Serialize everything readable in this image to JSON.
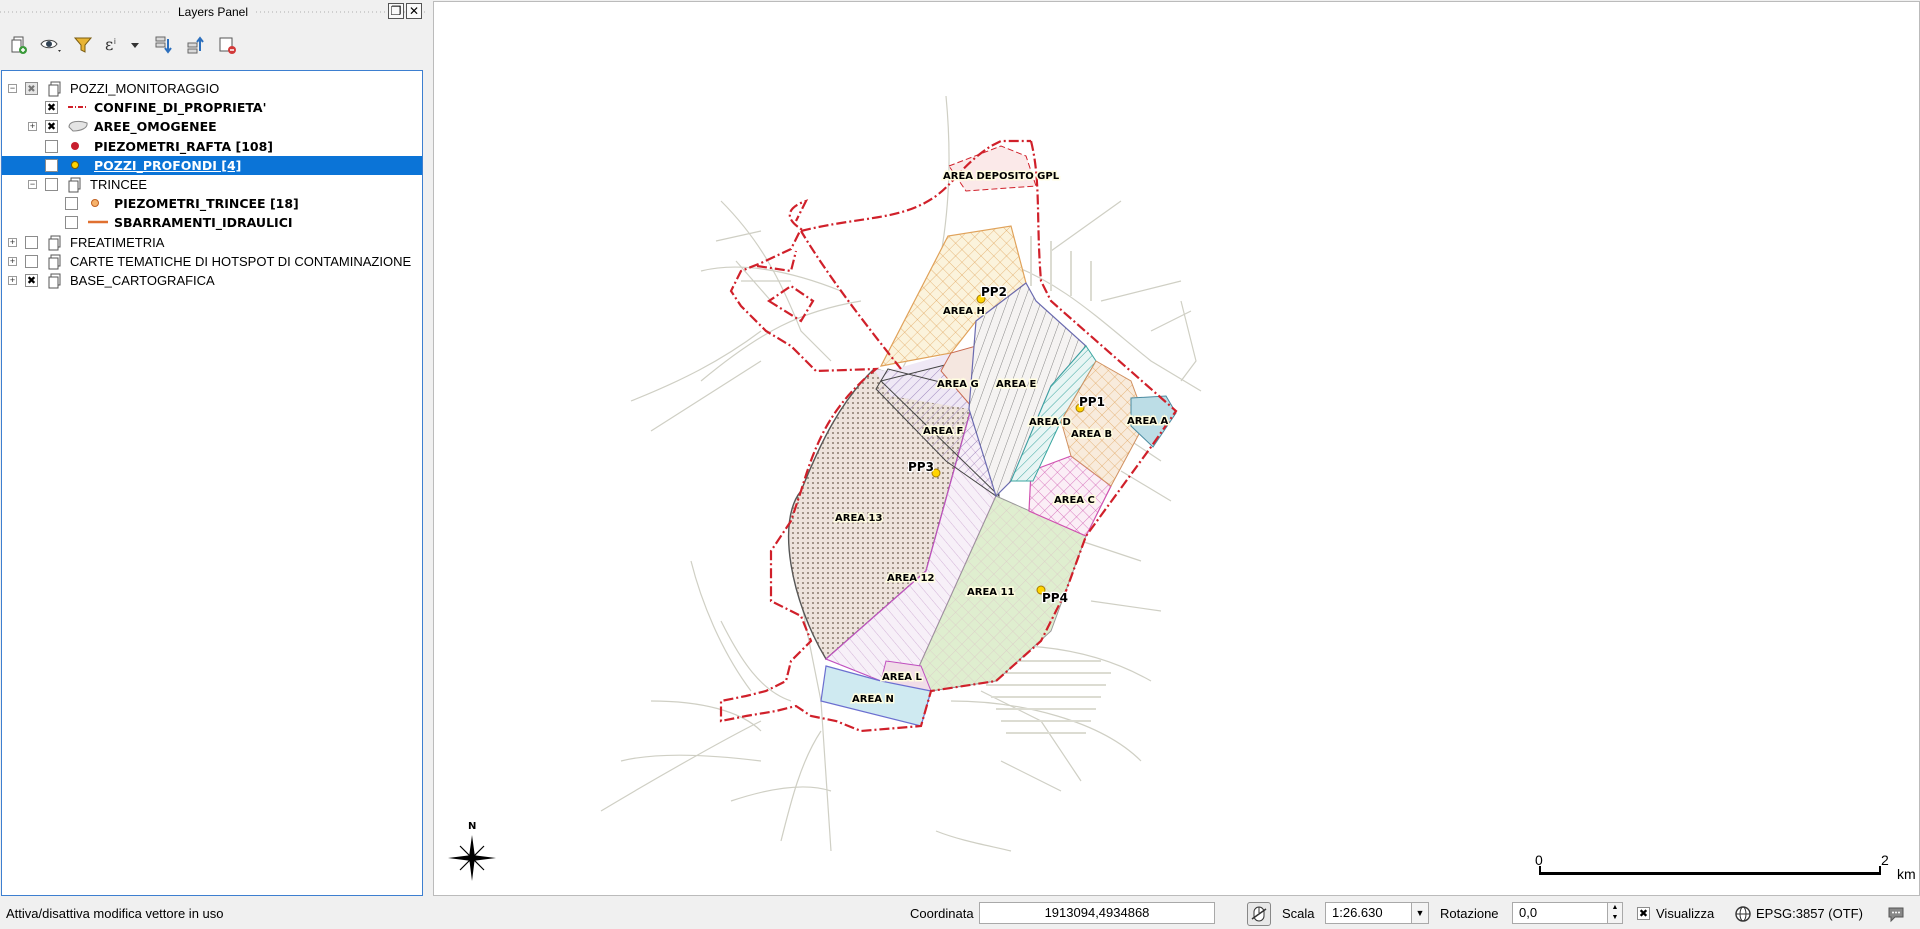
{
  "panel": {
    "title": "Layers Panel",
    "float_glyph": "❐",
    "close_glyph": "✕"
  },
  "toolbar_icons": [
    "add-group-icon",
    "eye-visibility-icon",
    "filter-legend-icon",
    "filter-expression-icon",
    "expand-all-icon",
    "collapse-all-icon",
    "remove-layer-icon"
  ],
  "layers": [
    {
      "label": "POZZI_MONITORAGGIO",
      "kind": "group",
      "check": "partial",
      "expander": "minus"
    },
    {
      "label": "CONFINE_DI_PROPRIETA'",
      "kind": "line-dashdot",
      "check": "on",
      "bold": true
    },
    {
      "label": "AREE_OMOGENEE",
      "kind": "polygon",
      "check": "on",
      "bold": true,
      "expander": "plus"
    },
    {
      "label": "PIEZOMETRI_RAFTA [108]",
      "kind": "point-red",
      "check": "off",
      "bold": true
    },
    {
      "label": "POZZI_PROFONDI [4]",
      "kind": "point-yellow",
      "check": "on",
      "bold": true,
      "selected": true
    },
    {
      "label": "TRINCEE",
      "kind": "group",
      "check": "off",
      "expander": "minus"
    },
    {
      "label": "PIEZOMETRI_TRINCEE [18]",
      "kind": "point-orange",
      "check": "off",
      "bold": true
    },
    {
      "label": "SBARRAMENTI_IDRAULICI",
      "kind": "line-orange",
      "check": "off",
      "bold": true
    },
    {
      "label": "FREATIMETRIA",
      "kind": "group",
      "check": "off",
      "expander": "plus"
    },
    {
      "label": "CARTE TEMATICHE DI HOTSPOT DI CONTAMINAZIONE",
      "kind": "group",
      "check": "off",
      "expander": "plus"
    },
    {
      "label": "BASE_CARTOGRAFICA",
      "kind": "group",
      "check": "on",
      "expander": "plus"
    }
  ],
  "map": {
    "area_labels": [
      {
        "text": "AREA DEPOSITO GPL"
      },
      {
        "text": "AREA H"
      },
      {
        "text": "AREA G"
      },
      {
        "text": "AREA E"
      },
      {
        "text": "AREA D"
      },
      {
        "text": "AREA B"
      },
      {
        "text": "AREA A"
      },
      {
        "text": "AREA F"
      },
      {
        "text": "AREA C"
      },
      {
        "text": "AREA 13"
      },
      {
        "text": "AREA 12"
      },
      {
        "text": "AREA 11"
      },
      {
        "text": "AREA L"
      },
      {
        "text": "AREA N"
      }
    ],
    "wells": [
      {
        "text": "PP2"
      },
      {
        "text": "PP1"
      },
      {
        "text": "PP3"
      },
      {
        "text": "PP4"
      }
    ],
    "north_label": "N",
    "scalebar": {
      "start": "0",
      "end": "2",
      "unit": "km"
    }
  },
  "status": {
    "message": "Attiva/disattiva modifica vettore in uso",
    "coord_label": "Coordinata",
    "coord_value": "1913094,4934868",
    "scale_label": "Scala",
    "scale_value": "1:26.630",
    "rotation_label": "Rotazione",
    "rotation_value": "0,0",
    "render_label": "Visualizza",
    "crs": "EPSG:3857 (OTF)"
  },
  "colors": {
    "selection": "#0b74d7",
    "boundary": "#d0202a",
    "tree_border": "#3d7fd0"
  }
}
